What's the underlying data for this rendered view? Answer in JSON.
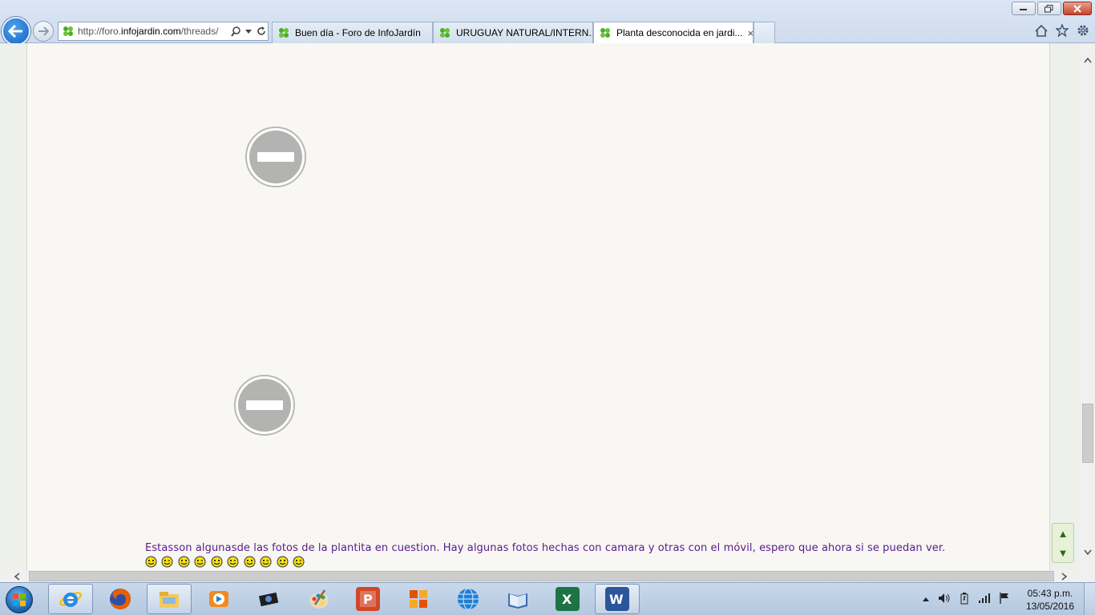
{
  "browser": {
    "address_url_prefix": "http://foro.",
    "address_url_domain": "infojardin.com",
    "address_url_suffix": "/threads/",
    "tabs": [
      {
        "label": "Buen día - Foro de InfoJardín",
        "active": false
      },
      {
        "label": "URUGUAY NATURAL/INTERN...",
        "active": false
      },
      {
        "label": "Planta desconocida en jardi...",
        "active": true
      }
    ],
    "tab_close_glyph": "×"
  },
  "page": {
    "post_text": "Estasson algunasde las fotos de la plantita en cuestion. Hay algunas fotos hechas con camara y otras con el móvil, espero que ahora si se puedan ver.",
    "smiley_count": 10,
    "blocked_images": [
      "blocked-image-icon",
      "blocked-image-icon"
    ]
  },
  "taskbar": {
    "apps": [
      "internet-explorer-icon",
      "firefox-icon",
      "file-explorer-icon",
      "media-player-icon",
      "photo-viewer-icon",
      "paint-icon",
      "powerpoint-icon",
      "office-tools-icon",
      "globe-icon",
      "book-icon",
      "excel-icon",
      "word-icon"
    ],
    "clock_time": "05:43 p.m.",
    "clock_date": "13/05/2016"
  },
  "colors": {
    "post_text": "#5a1a8c",
    "page_bg": "#f8f7f3",
    "tab_favicon": "#4caf23"
  }
}
